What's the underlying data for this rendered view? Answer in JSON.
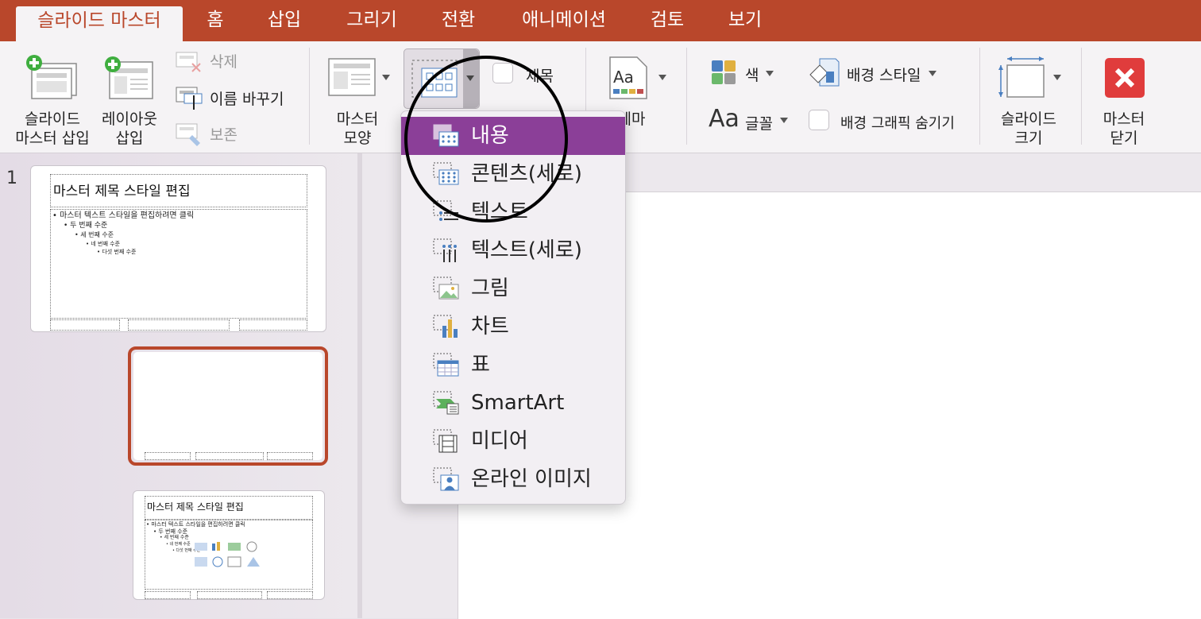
{
  "tabs": [
    {
      "label": "슬라이드 마스터",
      "active": true
    },
    {
      "label": "홈"
    },
    {
      "label": "삽입"
    },
    {
      "label": "그리기"
    },
    {
      "label": "전환"
    },
    {
      "label": "애니메이션"
    },
    {
      "label": "검토"
    },
    {
      "label": "보기"
    }
  ],
  "ribbon": {
    "insert_master_line1": "슬라이드",
    "insert_master_line2": "마스터 삽입",
    "insert_layout_line1": "레이아웃",
    "insert_layout_line2": "삽입",
    "delete": "삭제",
    "rename": "이름 바꾸기",
    "preserve": "보존",
    "master_layout_line1": "마스터",
    "master_layout_line2": "모양",
    "title_check": "제목",
    "theme": "테마",
    "colors": "색",
    "fonts": "글꼴",
    "bg_style": "배경 스타일",
    "hide_bg": "배경 그래픽 숨기기",
    "slide_size_line1": "슬라이드",
    "slide_size_line2": "크기",
    "close_master_line1": "마스터",
    "close_master_line2": "닫기"
  },
  "thumbnails": {
    "index": "1",
    "master_title": "마스터 제목 스타일 편집",
    "level1": "• 마스터 텍스트 스타일을 편집하려면 클릭",
    "level2": "• 두 번째 수준",
    "level3": "• 세 번째 수준",
    "level4": "• 네 번째 수준",
    "level5": "• 다섯 번째 수준"
  },
  "dropdown": {
    "items": [
      {
        "label": "내용",
        "icon": "content-placeholder-icon",
        "selected": true
      },
      {
        "label": "콘텐츠(세로)",
        "icon": "vertical-content-icon"
      },
      {
        "label": "텍스트",
        "icon": "text-placeholder-icon"
      },
      {
        "label": "텍스트(세로)",
        "icon": "vertical-text-icon"
      },
      {
        "label": "그림",
        "icon": "picture-icon"
      },
      {
        "label": "차트",
        "icon": "chart-icon"
      },
      {
        "label": "표",
        "icon": "table-icon"
      },
      {
        "label": "SmartArt",
        "icon": "smartart-icon"
      },
      {
        "label": "미디어",
        "icon": "media-icon"
      },
      {
        "label": "온라인 이미지",
        "icon": "online-image-icon"
      }
    ]
  },
  "colors": {
    "accent": "#b9472b",
    "selection": "#8b3f98",
    "close": "#e03c3c"
  }
}
